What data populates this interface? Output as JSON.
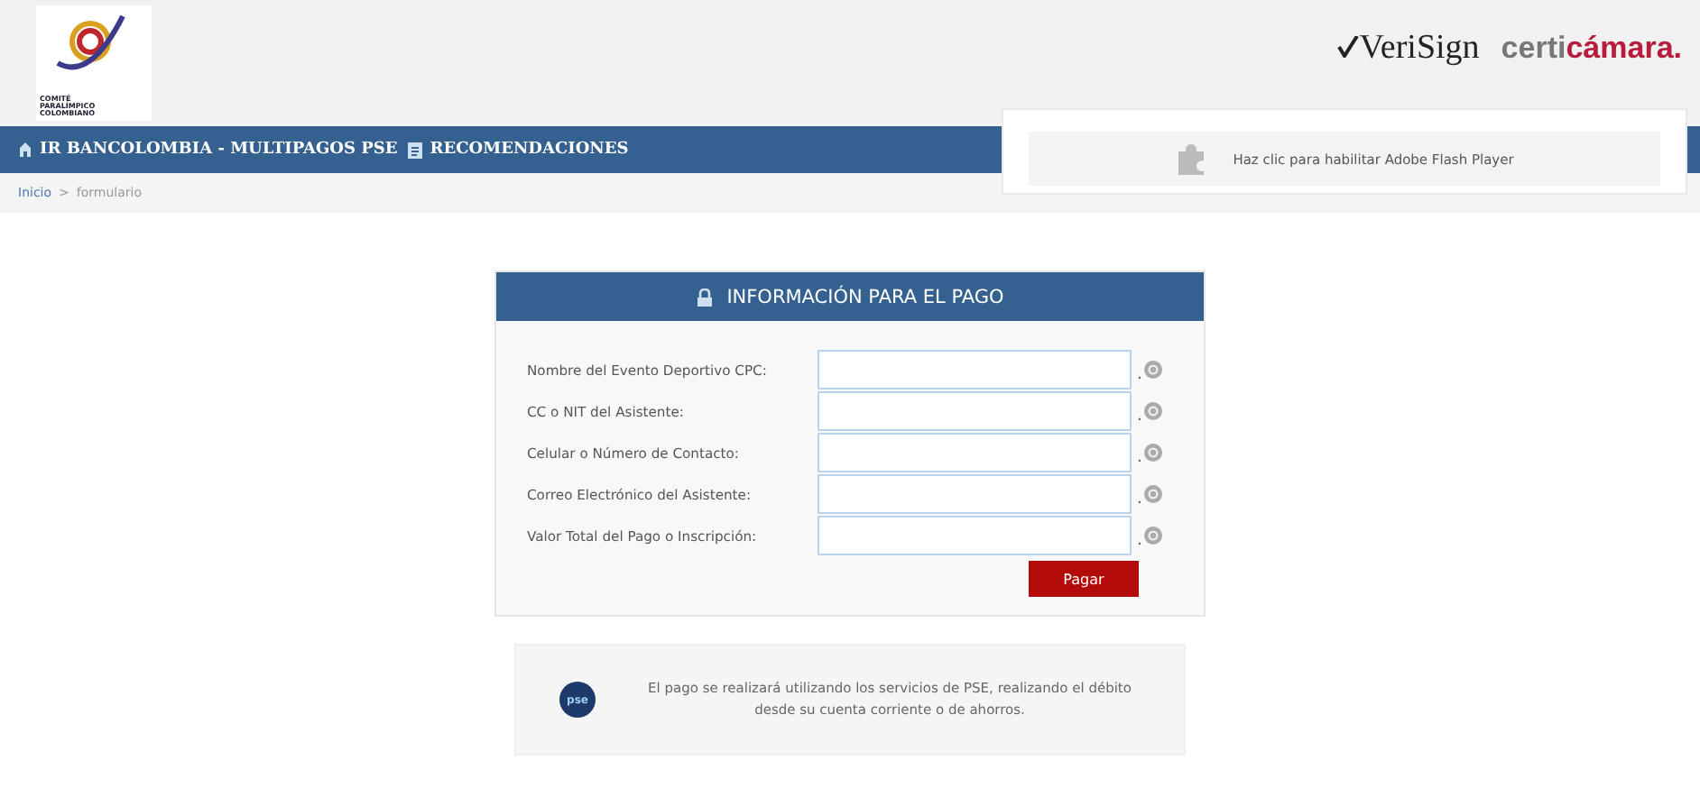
{
  "header": {
    "logo_text": [
      "COMITÉ",
      "PARALÍMPICO",
      "COLOMBIANO"
    ],
    "partner_logos": [
      {
        "kind": "verisign",
        "text": "VeriSign"
      },
      {
        "kind": "certicamara",
        "text": "certi",
        "accent": "cámara."
      }
    ]
  },
  "nav": {
    "items": [
      {
        "kind": "home",
        "label": "IR BANCOLOMBIA - MULTIPAGOS PSE"
      },
      {
        "kind": "doc",
        "label": "RECOMENDACIONES"
      }
    ]
  },
  "flash_overlay": {
    "message": "Haz clic para habilitar Adobe Flash Player"
  },
  "breadcrumb": [
    "Inicio",
    ">",
    "formulario"
  ],
  "form": {
    "title": "INFORMACIÓN PARA EL PAGO",
    "fields": [
      {
        "label": "Nombre del Evento Deportivo CPC:",
        "required_mark": "."
      },
      {
        "label": "CC o NIT del Asistente:",
        "required_mark": "."
      },
      {
        "label": "Celular o Número de Contacto:",
        "required_mark": "."
      },
      {
        "label": "Correo Electrónico del Asistente:",
        "required_mark": "."
      },
      {
        "label": "Valor Total del Pago o Inscripción:",
        "required_mark": "."
      }
    ],
    "submit": "Pagar"
  },
  "notice": {
    "badge": "pse",
    "text": "El pago se realizará utilizando los servicios de PSE, realizando el débito desde su cuenta corriente o de ahorros."
  }
}
